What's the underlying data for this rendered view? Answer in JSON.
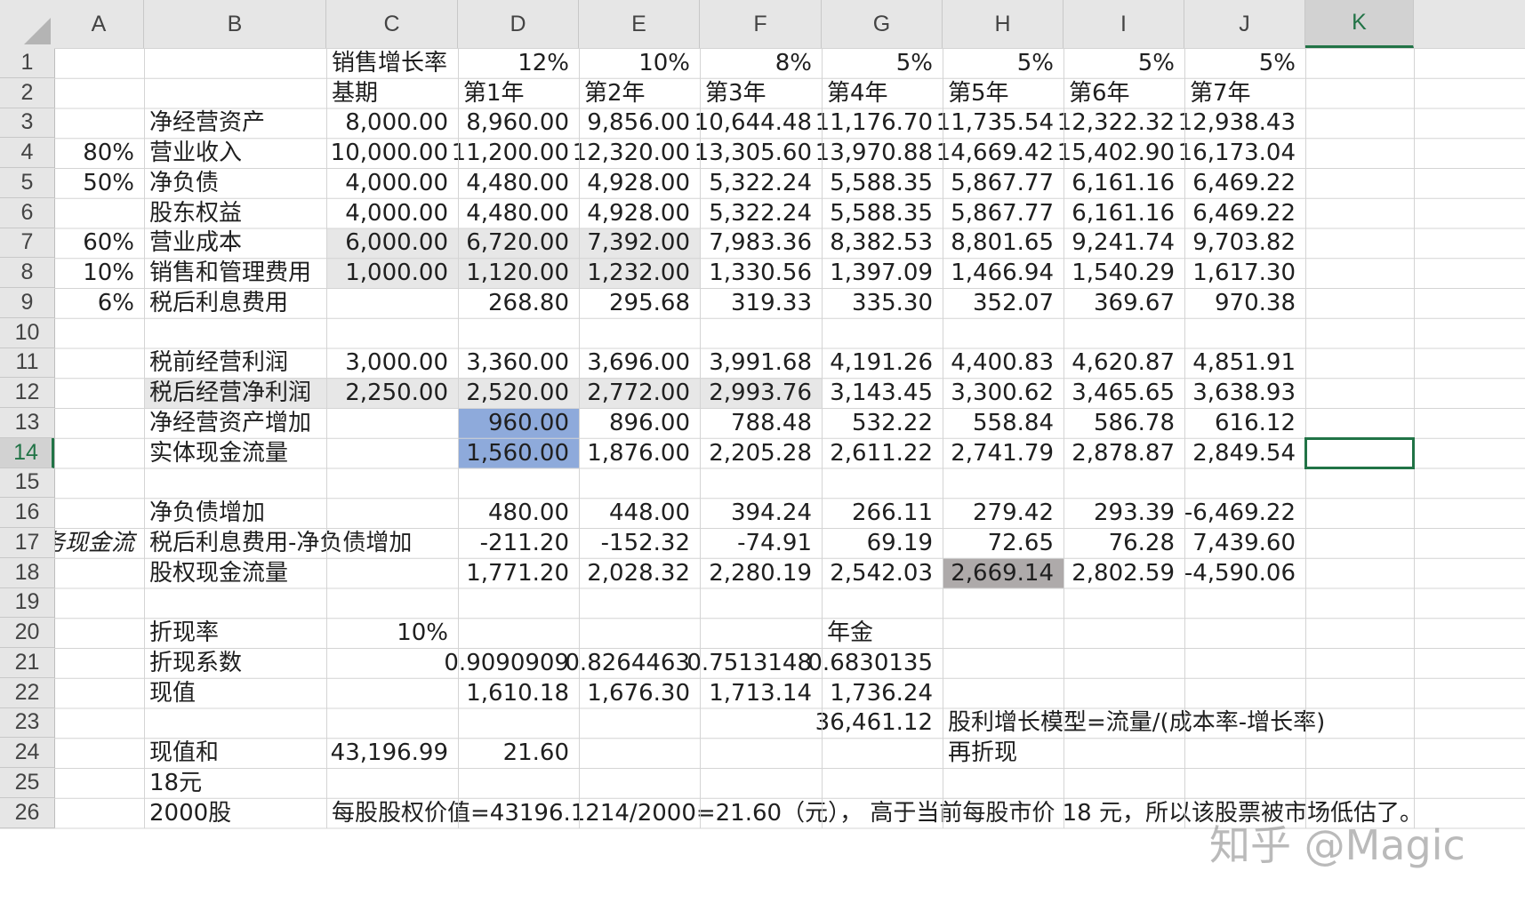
{
  "columns": [
    "A",
    "B",
    "C",
    "D",
    "E",
    "F",
    "G",
    "H",
    "I",
    "J",
    "K"
  ],
  "rows": [
    "1",
    "2",
    "3",
    "4",
    "5",
    "6",
    "7",
    "8",
    "9",
    "10",
    "11",
    "12",
    "13",
    "14",
    "15",
    "16",
    "17",
    "18",
    "19",
    "20",
    "21",
    "22",
    "23",
    "24",
    "25",
    "26"
  ],
  "colors": {
    "header_bg": "#e6e6e6",
    "selection_green": "#217346",
    "light_gray_fill": "#e7e7e7",
    "blue_fill": "#8eaadb",
    "dark_gray_fill": "#aeaaaa"
  },
  "selected_cell": "K14",
  "cells": [
    {
      "ref": "C1",
      "value": "销售增长率",
      "kind": "txt"
    },
    {
      "ref": "D1",
      "value": "12%",
      "kind": "num"
    },
    {
      "ref": "E1",
      "value": "10%",
      "kind": "num"
    },
    {
      "ref": "F1",
      "value": "8%",
      "kind": "num"
    },
    {
      "ref": "G1",
      "value": "5%",
      "kind": "num"
    },
    {
      "ref": "H1",
      "value": "5%",
      "kind": "num"
    },
    {
      "ref": "I1",
      "value": "5%",
      "kind": "num"
    },
    {
      "ref": "J1",
      "value": "5%",
      "kind": "num"
    },
    {
      "ref": "C2",
      "value": "基期",
      "kind": "txt"
    },
    {
      "ref": "D2",
      "value": "第1年",
      "kind": "txt"
    },
    {
      "ref": "E2",
      "value": "第2年",
      "kind": "txt"
    },
    {
      "ref": "F2",
      "value": "第3年",
      "kind": "txt"
    },
    {
      "ref": "G2",
      "value": "第4年",
      "kind": "txt"
    },
    {
      "ref": "H2",
      "value": "第5年",
      "kind": "txt"
    },
    {
      "ref": "I2",
      "value": "第6年",
      "kind": "txt"
    },
    {
      "ref": "J2",
      "value": "第7年",
      "kind": "txt"
    },
    {
      "ref": "B3",
      "value": "净经营资产",
      "kind": "txt"
    },
    {
      "ref": "C3",
      "value": "8,000.00",
      "kind": "num"
    },
    {
      "ref": "D3",
      "value": "8,960.00",
      "kind": "num"
    },
    {
      "ref": "E3",
      "value": "9,856.00",
      "kind": "num"
    },
    {
      "ref": "F3",
      "value": "10,644.48",
      "kind": "num"
    },
    {
      "ref": "G3",
      "value": "11,176.70",
      "kind": "num"
    },
    {
      "ref": "H3",
      "value": "11,735.54",
      "kind": "num"
    },
    {
      "ref": "I3",
      "value": "12,322.32",
      "kind": "num"
    },
    {
      "ref": "J3",
      "value": "12,938.43",
      "kind": "num"
    },
    {
      "ref": "A4",
      "value": "80%",
      "kind": "num"
    },
    {
      "ref": "B4",
      "value": "营业收入",
      "kind": "txt"
    },
    {
      "ref": "C4",
      "value": "10,000.00",
      "kind": "num"
    },
    {
      "ref": "D4",
      "value": "11,200.00",
      "kind": "num"
    },
    {
      "ref": "E4",
      "value": "12,320.00",
      "kind": "num"
    },
    {
      "ref": "F4",
      "value": "13,305.60",
      "kind": "num"
    },
    {
      "ref": "G4",
      "value": "13,970.88",
      "kind": "num"
    },
    {
      "ref": "H4",
      "value": "14,669.42",
      "kind": "num"
    },
    {
      "ref": "I4",
      "value": "15,402.90",
      "kind": "num"
    },
    {
      "ref": "J4",
      "value": "16,173.04",
      "kind": "num"
    },
    {
      "ref": "A5",
      "value": "50%",
      "kind": "num"
    },
    {
      "ref": "B5",
      "value": "净负债",
      "kind": "txt"
    },
    {
      "ref": "C5",
      "value": "4,000.00",
      "kind": "num"
    },
    {
      "ref": "D5",
      "value": "4,480.00",
      "kind": "num"
    },
    {
      "ref": "E5",
      "value": "4,928.00",
      "kind": "num"
    },
    {
      "ref": "F5",
      "value": "5,322.24",
      "kind": "num"
    },
    {
      "ref": "G5",
      "value": "5,588.35",
      "kind": "num"
    },
    {
      "ref": "H5",
      "value": "5,867.77",
      "kind": "num"
    },
    {
      "ref": "I5",
      "value": "6,161.16",
      "kind": "num"
    },
    {
      "ref": "J5",
      "value": "6,469.22",
      "kind": "num"
    },
    {
      "ref": "B6",
      "value": "股东权益",
      "kind": "txt"
    },
    {
      "ref": "C6",
      "value": "4,000.00",
      "kind": "num"
    },
    {
      "ref": "D6",
      "value": "4,480.00",
      "kind": "num"
    },
    {
      "ref": "E6",
      "value": "4,928.00",
      "kind": "num"
    },
    {
      "ref": "F6",
      "value": "5,322.24",
      "kind": "num"
    },
    {
      "ref": "G6",
      "value": "5,588.35",
      "kind": "num"
    },
    {
      "ref": "H6",
      "value": "5,867.77",
      "kind": "num"
    },
    {
      "ref": "I6",
      "value": "6,161.16",
      "kind": "num"
    },
    {
      "ref": "J6",
      "value": "6,469.22",
      "kind": "num"
    },
    {
      "ref": "A7",
      "value": "60%",
      "kind": "num"
    },
    {
      "ref": "B7",
      "value": "营业成本",
      "kind": "txt"
    },
    {
      "ref": "C7",
      "value": "6,000.00",
      "kind": "num",
      "fill": "gray"
    },
    {
      "ref": "D7",
      "value": "6,720.00",
      "kind": "num",
      "fill": "gray"
    },
    {
      "ref": "E7",
      "value": "7,392.00",
      "kind": "num",
      "fill": "gray"
    },
    {
      "ref": "F7",
      "value": "7,983.36",
      "kind": "num"
    },
    {
      "ref": "G7",
      "value": "8,382.53",
      "kind": "num"
    },
    {
      "ref": "H7",
      "value": "8,801.65",
      "kind": "num"
    },
    {
      "ref": "I7",
      "value": "9,241.74",
      "kind": "num"
    },
    {
      "ref": "J7",
      "value": "9,703.82",
      "kind": "num"
    },
    {
      "ref": "A8",
      "value": "10%",
      "kind": "num"
    },
    {
      "ref": "B8",
      "value": "销售和管理费用",
      "kind": "txt"
    },
    {
      "ref": "C8",
      "value": "1,000.00",
      "kind": "num",
      "fill": "gray"
    },
    {
      "ref": "D8",
      "value": "1,120.00",
      "kind": "num",
      "fill": "gray"
    },
    {
      "ref": "E8",
      "value": "1,232.00",
      "kind": "num",
      "fill": "gray"
    },
    {
      "ref": "F8",
      "value": "1,330.56",
      "kind": "num"
    },
    {
      "ref": "G8",
      "value": "1,397.09",
      "kind": "num"
    },
    {
      "ref": "H8",
      "value": "1,466.94",
      "kind": "num"
    },
    {
      "ref": "I8",
      "value": "1,540.29",
      "kind": "num"
    },
    {
      "ref": "J8",
      "value": "1,617.30",
      "kind": "num"
    },
    {
      "ref": "A9",
      "value": "6%",
      "kind": "num"
    },
    {
      "ref": "B9",
      "value": "税后利息费用",
      "kind": "txt"
    },
    {
      "ref": "D9",
      "value": "268.80",
      "kind": "num"
    },
    {
      "ref": "E9",
      "value": "295.68",
      "kind": "num"
    },
    {
      "ref": "F9",
      "value": "319.33",
      "kind": "num"
    },
    {
      "ref": "G9",
      "value": "335.30",
      "kind": "num"
    },
    {
      "ref": "H9",
      "value": "352.07",
      "kind": "num"
    },
    {
      "ref": "I9",
      "value": "369.67",
      "kind": "num"
    },
    {
      "ref": "J9",
      "value": "970.38",
      "kind": "num"
    },
    {
      "ref": "B11",
      "value": "税前经营利润",
      "kind": "txt"
    },
    {
      "ref": "C11",
      "value": "3,000.00",
      "kind": "num"
    },
    {
      "ref": "D11",
      "value": "3,360.00",
      "kind": "num"
    },
    {
      "ref": "E11",
      "value": "3,696.00",
      "kind": "num"
    },
    {
      "ref": "F11",
      "value": "3,991.68",
      "kind": "num"
    },
    {
      "ref": "G11",
      "value": "4,191.26",
      "kind": "num"
    },
    {
      "ref": "H11",
      "value": "4,400.83",
      "kind": "num"
    },
    {
      "ref": "I11",
      "value": "4,620.87",
      "kind": "num"
    },
    {
      "ref": "J11",
      "value": "4,851.91",
      "kind": "num"
    },
    {
      "ref": "B12",
      "value": "税后经营净利润",
      "kind": "txt",
      "fill": "gray"
    },
    {
      "ref": "C12",
      "value": "2,250.00",
      "kind": "num",
      "fill": "gray"
    },
    {
      "ref": "D12",
      "value": "2,520.00",
      "kind": "num",
      "fill": "gray"
    },
    {
      "ref": "E12",
      "value": "2,772.00",
      "kind": "num",
      "fill": "gray"
    },
    {
      "ref": "F12",
      "value": "2,993.76",
      "kind": "num",
      "fill": "gray"
    },
    {
      "ref": "G12",
      "value": "3,143.45",
      "kind": "num"
    },
    {
      "ref": "H12",
      "value": "3,300.62",
      "kind": "num"
    },
    {
      "ref": "I12",
      "value": "3,465.65",
      "kind": "num"
    },
    {
      "ref": "J12",
      "value": "3,638.93",
      "kind": "num"
    },
    {
      "ref": "B13",
      "value": "净经营资产增加",
      "kind": "txt"
    },
    {
      "ref": "D13",
      "value": "960.00",
      "kind": "num",
      "fill": "blue"
    },
    {
      "ref": "E13",
      "value": "896.00",
      "kind": "num"
    },
    {
      "ref": "F13",
      "value": "788.48",
      "kind": "num"
    },
    {
      "ref": "G13",
      "value": "532.22",
      "kind": "num"
    },
    {
      "ref": "H13",
      "value": "558.84",
      "kind": "num"
    },
    {
      "ref": "I13",
      "value": "586.78",
      "kind": "num"
    },
    {
      "ref": "J13",
      "value": "616.12",
      "kind": "num"
    },
    {
      "ref": "B14",
      "value": "实体现金流量",
      "kind": "txt"
    },
    {
      "ref": "D14",
      "value": "1,560.00",
      "kind": "num",
      "fill": "blue"
    },
    {
      "ref": "E14",
      "value": "1,876.00",
      "kind": "num"
    },
    {
      "ref": "F14",
      "value": "2,205.28",
      "kind": "num"
    },
    {
      "ref": "G14",
      "value": "2,611.22",
      "kind": "num"
    },
    {
      "ref": "H14",
      "value": "2,741.79",
      "kind": "num"
    },
    {
      "ref": "I14",
      "value": "2,878.87",
      "kind": "num"
    },
    {
      "ref": "J14",
      "value": "2,849.54",
      "kind": "num"
    },
    {
      "ref": "B16",
      "value": "净负债增加",
      "kind": "txt"
    },
    {
      "ref": "D16",
      "value": "480.00",
      "kind": "num"
    },
    {
      "ref": "E16",
      "value": "448.00",
      "kind": "num"
    },
    {
      "ref": "F16",
      "value": "394.24",
      "kind": "num"
    },
    {
      "ref": "G16",
      "value": "266.11",
      "kind": "num"
    },
    {
      "ref": "H16",
      "value": "279.42",
      "kind": "num"
    },
    {
      "ref": "I16",
      "value": "293.39",
      "kind": "num"
    },
    {
      "ref": "J16",
      "value": "-6,469.22",
      "kind": "num"
    },
    {
      "ref": "A17",
      "value": "务现金流",
      "kind": "num",
      "italic": true
    },
    {
      "ref": "B17",
      "value": "税后利息费用-净负债增加",
      "kind": "txt"
    },
    {
      "ref": "D17",
      "value": "-211.20",
      "kind": "num"
    },
    {
      "ref": "E17",
      "value": "-152.32",
      "kind": "num"
    },
    {
      "ref": "F17",
      "value": "-74.91",
      "kind": "num"
    },
    {
      "ref": "G17",
      "value": "69.19",
      "kind": "num"
    },
    {
      "ref": "H17",
      "value": "72.65",
      "kind": "num"
    },
    {
      "ref": "I17",
      "value": "76.28",
      "kind": "num"
    },
    {
      "ref": "J17",
      "value": "7,439.60",
      "kind": "num"
    },
    {
      "ref": "B18",
      "value": "股权现金流量",
      "kind": "txt"
    },
    {
      "ref": "D18",
      "value": "1,771.20",
      "kind": "num"
    },
    {
      "ref": "E18",
      "value": "2,028.32",
      "kind": "num"
    },
    {
      "ref": "F18",
      "value": "2,280.19",
      "kind": "num"
    },
    {
      "ref": "G18",
      "value": "2,542.03",
      "kind": "num"
    },
    {
      "ref": "H18",
      "value": "2,669.14",
      "kind": "num",
      "fill": "dark"
    },
    {
      "ref": "I18",
      "value": "2,802.59",
      "kind": "num"
    },
    {
      "ref": "J18",
      "value": "-4,590.06",
      "kind": "num"
    },
    {
      "ref": "B20",
      "value": "折现率",
      "kind": "txt"
    },
    {
      "ref": "C20",
      "value": "10%",
      "kind": "num"
    },
    {
      "ref": "G20",
      "value": "年金",
      "kind": "txt"
    },
    {
      "ref": "B21",
      "value": "折现系数",
      "kind": "txt"
    },
    {
      "ref": "D21",
      "value": "0.9090909",
      "kind": "num"
    },
    {
      "ref": "E21",
      "value": "0.8264463",
      "kind": "num"
    },
    {
      "ref": "F21",
      "value": "0.7513148",
      "kind": "num"
    },
    {
      "ref": "G21",
      "value": "0.6830135",
      "kind": "num"
    },
    {
      "ref": "B22",
      "value": "现值",
      "kind": "txt"
    },
    {
      "ref": "D22",
      "value": "1,610.18",
      "kind": "num"
    },
    {
      "ref": "E22",
      "value": "1,676.30",
      "kind": "num"
    },
    {
      "ref": "F22",
      "value": "1,713.14",
      "kind": "num"
    },
    {
      "ref": "G22",
      "value": "1,736.24",
      "kind": "num"
    },
    {
      "ref": "G23",
      "value": "36,461.12",
      "kind": "num"
    },
    {
      "ref": "H23",
      "value": "股利增长模型=流量/(成本率-增长率)",
      "kind": "txt"
    },
    {
      "ref": "B24",
      "value": "现值和",
      "kind": "txt"
    },
    {
      "ref": "C24",
      "value": "43,196.99",
      "kind": "num"
    },
    {
      "ref": "D24",
      "value": "21.60",
      "kind": "num"
    },
    {
      "ref": "H24",
      "value": "再折现",
      "kind": "txt"
    },
    {
      "ref": "B25",
      "value": "18元",
      "kind": "txt"
    },
    {
      "ref": "B26",
      "value": "2000股",
      "kind": "txt"
    },
    {
      "ref": "C26",
      "value": "每股股权价值=43196.1214/2000=21.60（元）， 高于当前每股市价 18 元，所以该股票被市场低估了。",
      "kind": "txt"
    }
  ],
  "watermark": "知乎 @Magic"
}
